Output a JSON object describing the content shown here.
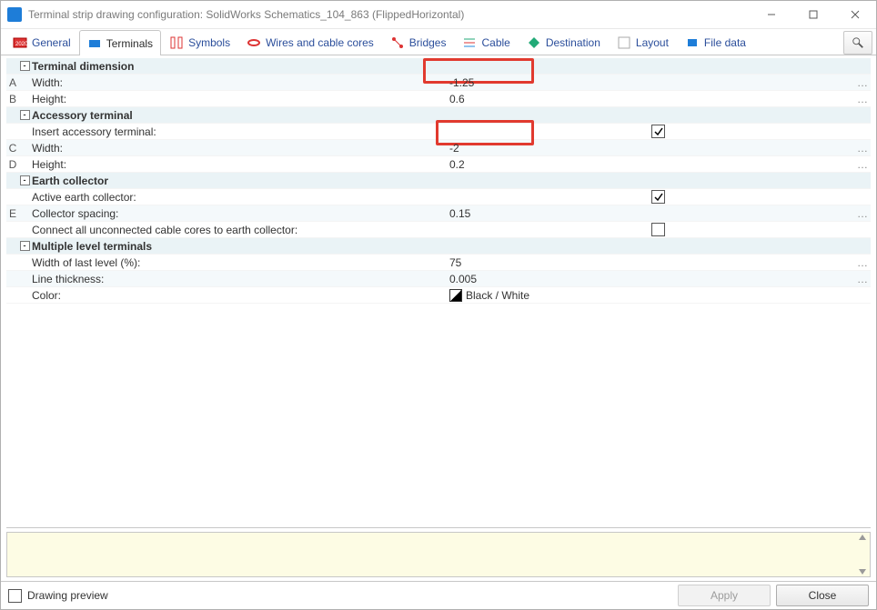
{
  "window": {
    "title": "Terminal strip drawing configuration: SolidWorks Schematics_104_863 (FlippedHorizontal)"
  },
  "tabs": {
    "general": "General",
    "terminals": "Terminals",
    "symbols": "Symbols",
    "wires": "Wires and cable cores",
    "bridges": "Bridges",
    "cable": "Cable",
    "destination": "Destination",
    "layout": "Layout",
    "filedata": "File data"
  },
  "sections": {
    "terminal_dimension": {
      "header": "Terminal dimension",
      "width": {
        "mark": "A",
        "label": "Width:",
        "value": "-1.25"
      },
      "height": {
        "mark": "B",
        "label": "Height:",
        "value": "0.6"
      }
    },
    "accessory_terminal": {
      "header": "Accessory terminal",
      "insert": {
        "label": "Insert accessory terminal:",
        "checked": true
      },
      "width": {
        "mark": "C",
        "label": "Width:",
        "value": "-2"
      },
      "height": {
        "mark": "D",
        "label": "Height:",
        "value": "0.2"
      }
    },
    "earth_collector": {
      "header": "Earth collector",
      "active": {
        "label": "Active earth collector:",
        "checked": true
      },
      "spacing": {
        "mark": "E",
        "label": "Collector spacing:",
        "value": "0.15"
      },
      "connect": {
        "label": "Connect all unconnected cable cores to earth collector:",
        "checked": false
      }
    },
    "multiple_level": {
      "header": "Multiple level terminals",
      "width_last": {
        "label": "Width of last level (%):",
        "value": "75"
      },
      "line_thickness": {
        "label": "Line thickness:",
        "value": "0.005"
      },
      "color": {
        "label": "Color:",
        "value": "Black / White"
      }
    }
  },
  "footer": {
    "drawing_preview": "Drawing preview",
    "apply": "Apply",
    "close": "Close"
  }
}
